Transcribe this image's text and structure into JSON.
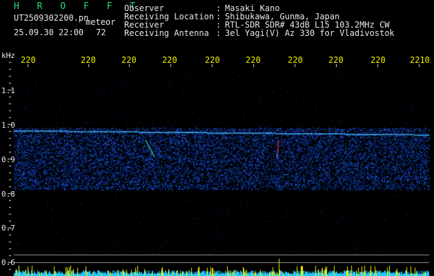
{
  "header": {
    "title": "H R O F F T",
    "filename": "UT2509302200.pn",
    "type": "meteor",
    "datetime": "25.09.30 22:00",
    "count": "72"
  },
  "info": [
    {
      "key": "Observer",
      "value": "Masaki Kano"
    },
    {
      "key": "Receiving Location",
      "value": "Shibukawa, Gunma, Japan"
    },
    {
      "key": "Receiver",
      "value": "RTL-SDR SDR# 43dB L15 103.2MHz CW"
    },
    {
      "key": "Receiving Antenna",
      "value": "3el Yagi(V) Az 330 for Vladivostok"
    }
  ],
  "separator": ":",
  "axis": {
    "y_unit": "kHz",
    "y_ticks": [
      "1.1",
      "1.0",
      "0.9",
      "0.8",
      "0.7",
      "0.6"
    ],
    "x_ticks": [
      "220",
      "220",
      "220",
      "220",
      "220",
      "220",
      "220",
      "220",
      "220",
      "2210"
    ]
  },
  "colors": {
    "background": "#000000",
    "text_header": "#22e07a",
    "text_info": "#e8e8e8",
    "x_ticks": "#f0f000",
    "signal_carrier": "#4aa8ff",
    "noise": "#1a2fb0",
    "bottom_bar": "#1ec8ff"
  }
}
